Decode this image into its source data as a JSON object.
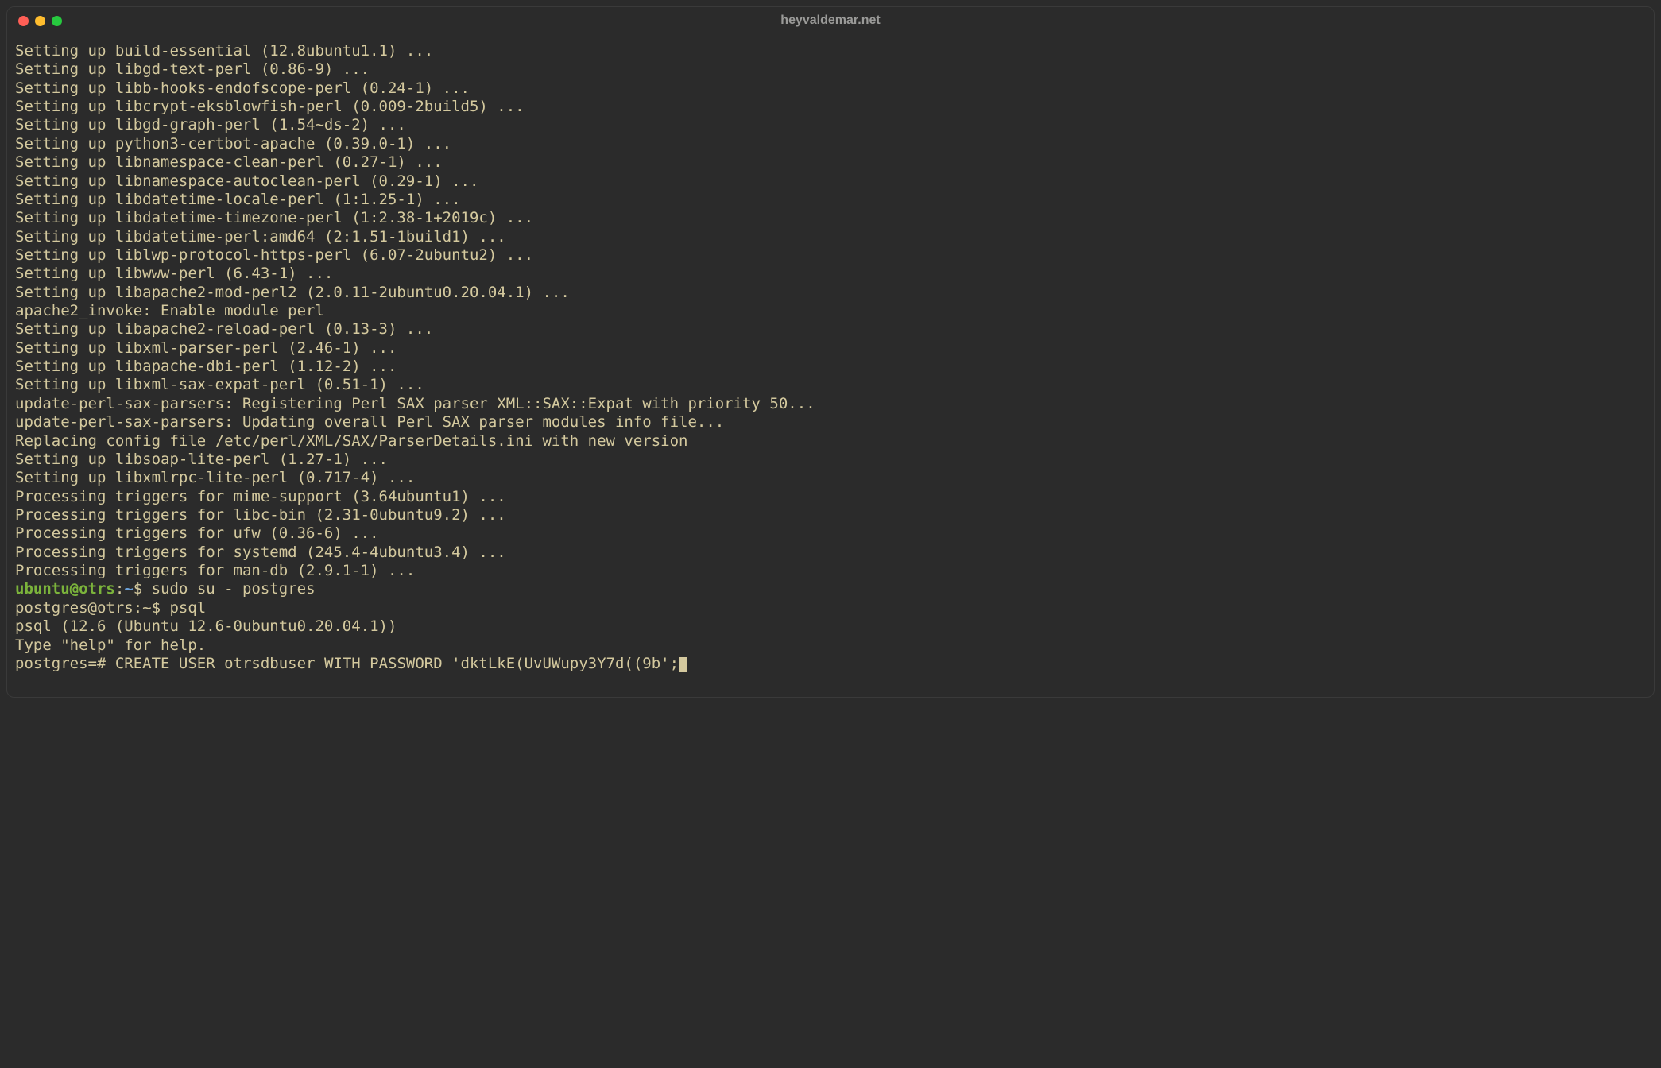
{
  "window": {
    "title": "heyvaldemar.net"
  },
  "output_lines": [
    "Setting up build-essential (12.8ubuntu1.1) ...",
    "Setting up libgd-text-perl (0.86-9) ...",
    "Setting up libb-hooks-endofscope-perl (0.24-1) ...",
    "Setting up libcrypt-eksblowfish-perl (0.009-2build5) ...",
    "Setting up libgd-graph-perl (1.54~ds-2) ...",
    "Setting up python3-certbot-apache (0.39.0-1) ...",
    "Setting up libnamespace-clean-perl (0.27-1) ...",
    "Setting up libnamespace-autoclean-perl (0.29-1) ...",
    "Setting up libdatetime-locale-perl (1:1.25-1) ...",
    "Setting up libdatetime-timezone-perl (1:2.38-1+2019c) ...",
    "Setting up libdatetime-perl:amd64 (2:1.51-1build1) ...",
    "Setting up liblwp-protocol-https-perl (6.07-2ubuntu2) ...",
    "Setting up libwww-perl (6.43-1) ...",
    "Setting up libapache2-mod-perl2 (2.0.11-2ubuntu0.20.04.1) ...",
    "apache2_invoke: Enable module perl",
    "Setting up libapache2-reload-perl (0.13-3) ...",
    "Setting up libxml-parser-perl (2.46-1) ...",
    "Setting up libapache-dbi-perl (1.12-2) ...",
    "Setting up libxml-sax-expat-perl (0.51-1) ...",
    "update-perl-sax-parsers: Registering Perl SAX parser XML::SAX::Expat with priority 50...",
    "update-perl-sax-parsers: Updating overall Perl SAX parser modules info file...",
    "Replacing config file /etc/perl/XML/SAX/ParserDetails.ini with new version",
    "Setting up libsoap-lite-perl (1.27-1) ...",
    "Setting up libxmlrpc-lite-perl (0.717-4) ...",
    "Processing triggers for mime-support (3.64ubuntu1) ...",
    "Processing triggers for libc-bin (2.31-0ubuntu9.2) ...",
    "Processing triggers for ufw (0.36-6) ...",
    "Processing triggers for systemd (245.4-4ubuntu3.4) ...",
    "Processing triggers for man-db (2.9.1-1) ..."
  ],
  "prompt1": {
    "user": "ubuntu",
    "at": "@",
    "host": "otrs",
    "colon": ":",
    "path": "~",
    "symbol": "$ ",
    "command": "sudo su - postgres"
  },
  "psql_lines": [
    "postgres@otrs:~$ psql",
    "psql (12.6 (Ubuntu 12.6-0ubuntu0.20.04.1))",
    "Type \"help\" for help.",
    ""
  ],
  "psql_prompt": {
    "prefix": "postgres=# ",
    "command": "CREATE USER otrsdbuser WITH PASSWORD 'dktLkE(UvUWupy3Y7d((9b';"
  }
}
